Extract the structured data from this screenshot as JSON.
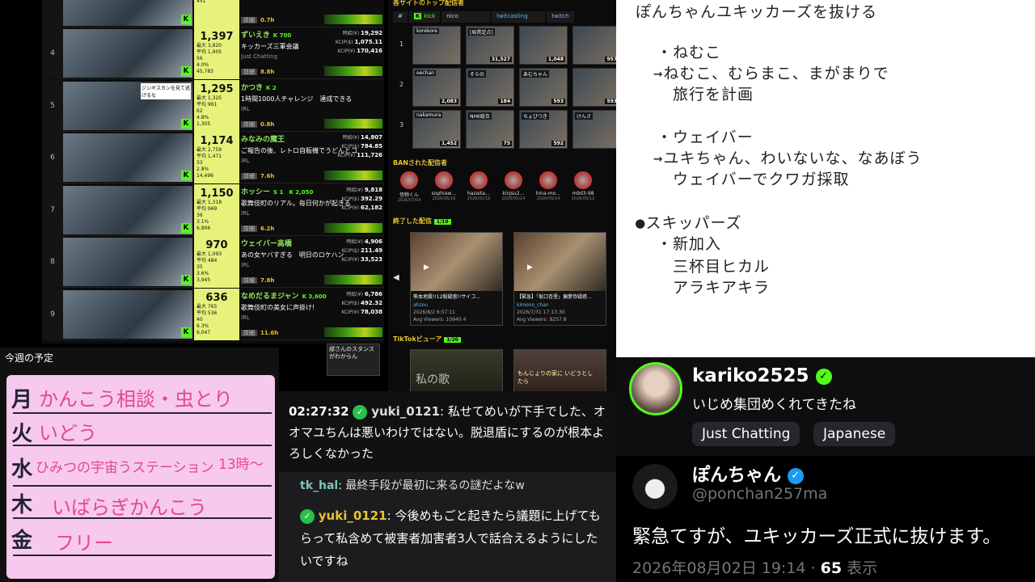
{
  "ranking": [
    {
      "rank": "",
      "viewers": "",
      "name": "",
      "title": "",
      "category": "Just Chatting",
      "duration": "0.7h",
      "s": [
        "824",
        "4%",
        "3.2%",
        "451"
      ],
      "nums": []
    },
    {
      "rank": "4",
      "viewers": "1,397",
      "name": "ずいえき",
      "badge": "K 700",
      "title": "キッカーズ三軍会議",
      "category": "Just Chatting",
      "duration": "8.8h",
      "s": [
        "最大 3,820",
        "平均 1,905",
        "56",
        "4.0%",
        "45,783"
      ],
      "nums": [
        "時給(¥) 19,292",
        "KCIP($) 1,075.11",
        "KCIP(¥) 170,416"
      ]
    },
    {
      "rank": "5",
      "viewers": "1,295",
      "name": "かつき",
      "badge": "K 2",
      "title": "1時間1000人チャレンジ　達成できる",
      "category": "IRL",
      "duration": "0.8h",
      "s": [
        "最大 1,325",
        "平均 961",
        "62",
        "4.8%",
        "1,305"
      ],
      "nums": [],
      "overlay": "ジンギスカンを見て逃げるな"
    },
    {
      "rank": "6",
      "viewers": "1,174",
      "name": "みなみの魔王",
      "badge": "",
      "title": "ご報告の後、レトロ自販機でうどんとコ",
      "category": "IRL",
      "duration": "7.6h",
      "s": [
        "最大 2,759",
        "平均 1,471",
        "33",
        "2.8%",
        "14,496"
      ],
      "nums": [
        "時給(¥) 14,807",
        "KCIP($) 784.85",
        "KCIP(¥) 111,726"
      ]
    },
    {
      "rank": "7",
      "viewers": "1,150",
      "name": "ホッシー",
      "badge": "S 1　K 2,050",
      "title": "歌舞伎町のリアル。毎日何かが起きる",
      "category": "IRL",
      "duration": "6.2h",
      "s": [
        "最大 1,318",
        "平均 969",
        "36",
        "3.1%",
        "6,906"
      ],
      "nums": [
        "時給(¥) 9,818",
        "KCIP($) 392.29",
        "KCIP(¥) 62,182"
      ]
    },
    {
      "rank": "8",
      "viewers": "970",
      "name": "ウェイバー高橋",
      "badge": "",
      "title": "あの女ヤバすぎる　明日のロケハン",
      "category": "IRL",
      "duration": "7.8h",
      "s": [
        "最大 1,093",
        "平均 484",
        "35",
        "3.6%",
        "3,945"
      ],
      "nums": [
        "時給(¥) 4,906",
        "KCIP($) 211.49",
        "KCIP(¥) 33,523"
      ]
    },
    {
      "rank": "9",
      "viewers": "636",
      "name": "なめだるまジャン",
      "badge": "K 3,600",
      "title": "歌舞伎町の美女に声掛け!",
      "category": "IRL",
      "duration": "11.6h",
      "s": [
        "最大 765",
        "平均 536",
        "40",
        "6.3%",
        "6,047"
      ],
      "nums": [
        "時給(¥) 6,786",
        "KCIP($) 492.32",
        "KCIP(¥) 78,038"
      ]
    }
  ],
  "detail_label": "詳細",
  "center": {
    "top_title": "各サイトのトップ配信者",
    "tabs": [
      "#",
      "kick",
      "nico",
      "twitcasting",
      "twitch"
    ],
    "grid": [
      [
        {
          "l": "korekore",
          "v": ""
        },
        {
          "l": "[局貫定点]",
          "v": "31,527"
        },
        {
          "l": "",
          "v": "1,048"
        },
        {
          "l": "",
          "v": "957"
        },
        {
          "l": "はりーシ",
          "v": ""
        }
      ],
      [
        {
          "l": "oechan",
          "v": "2,083"
        },
        {
          "l": "そらの",
          "v": "184"
        },
        {
          "l": "あむちゃん",
          "v": "593"
        },
        {
          "l": "",
          "v": "593"
        },
        {
          "l": "",
          "v": ""
        }
      ],
      [
        {
          "l": "nakamura",
          "v": "1,452"
        },
        {
          "l": "NHK総合",
          "v": "75"
        },
        {
          "l": "ちょびつき",
          "v": "592"
        },
        {
          "l": "けんさ",
          "v": ""
        },
        {
          "l": "",
          "v": ""
        }
      ]
    ],
    "ban_title": "BANされた配信者",
    "banned": [
      {
        "n": "怪物くん",
        "d": "2026/07/04"
      },
      {
        "n": "sophiaw…",
        "d": "2026/06/16"
      },
      {
        "n": "hazaita…",
        "d": "2026/05/16"
      },
      {
        "n": "kinjsu2…",
        "d": "2026/05/14"
      },
      {
        "n": "hina-mo…",
        "d": "2026/05/14"
      },
      {
        "n": "m9d3-98",
        "d": "2026/05/12"
      }
    ],
    "ended_title": "終了した配信",
    "ended_count": "1/10",
    "ended": [
      {
        "t": "熊本地震!!12殺疑惑!!サイコ…",
        "u": "ahzou",
        "d": "2026/8/2 6:57:11",
        "a": "Avg Viewers: 10940.4"
      },
      {
        "t": "【緊急】「坂口杏里」偏愛侍疑惑…",
        "u": "kimono_chan",
        "d": "2026/7/31 17:13:30",
        "a": "Avg Viewers: 9257.8"
      }
    ],
    "tiktok_title": "TikTokビューア",
    "tiktok_count": "1/20",
    "tiktok_overlay": "私の歌",
    "tiktok_overlay2": "もんじょりの家に いどうとしたら",
    "prev": "◀"
  },
  "notes": [
    "ぽんちゃんユキッカーズを抜ける",
    "・ねむこ",
    "→ねむこ、むらまこ、まがまりで",
    "旅行を計画",
    "・ウェイバー",
    "→ユキちゃん、わいないな、なあぼう",
    "ウェイバーでクワガ採取",
    "●スキッパーズ",
    "・新加入",
    "三杯目ヒカル",
    "アラキアキラ"
  ],
  "schedule": {
    "title": "今週の予定",
    "days": [
      "月",
      "火",
      "水",
      "木",
      "金"
    ],
    "items": [
      "かんこう相談・虫とり",
      "いどう",
      "ひみつの宇宙うステーション",
      "13時〜",
      "いばらぎかんこう",
      "フリー"
    ],
    "bubble": "緑さんのスタンスがわからん"
  },
  "chat": {
    "time": "02:27:32",
    "user1": "yuki_0121",
    "msg1": "私せてめいが下手でした、オオマユちんは悪いわけではない。脱退盾にするのが根本よろしくなかった",
    "user2": "tk_hal",
    "msg2": "最終手段が最初に来るの謎だよなw",
    "user3": "yuki_0121",
    "msg3": "今後めもごと起きたら議題に上げてもらって私含めて被害者加害者3人で話合えるようにしたいですね"
  },
  "profile": {
    "name": "kariko2525",
    "title": "いじめ集団めくれてきたね",
    "tags": [
      "Just Chatting",
      "Japanese"
    ]
  },
  "tweet": {
    "name": "ぽんちゃん",
    "handle": "@ponchan257ma",
    "text": "緊急てすが、ユキッカーズ正式に抜けます。",
    "date": "2026年08月02日 19:14 · ",
    "views": "65",
    "views_label": " 表示"
  },
  "colors": {
    "kick": "#53fc18",
    "highlight": "#e7f27a",
    "verified": "#1d9bf0",
    "pink": "#f7c9ef"
  }
}
